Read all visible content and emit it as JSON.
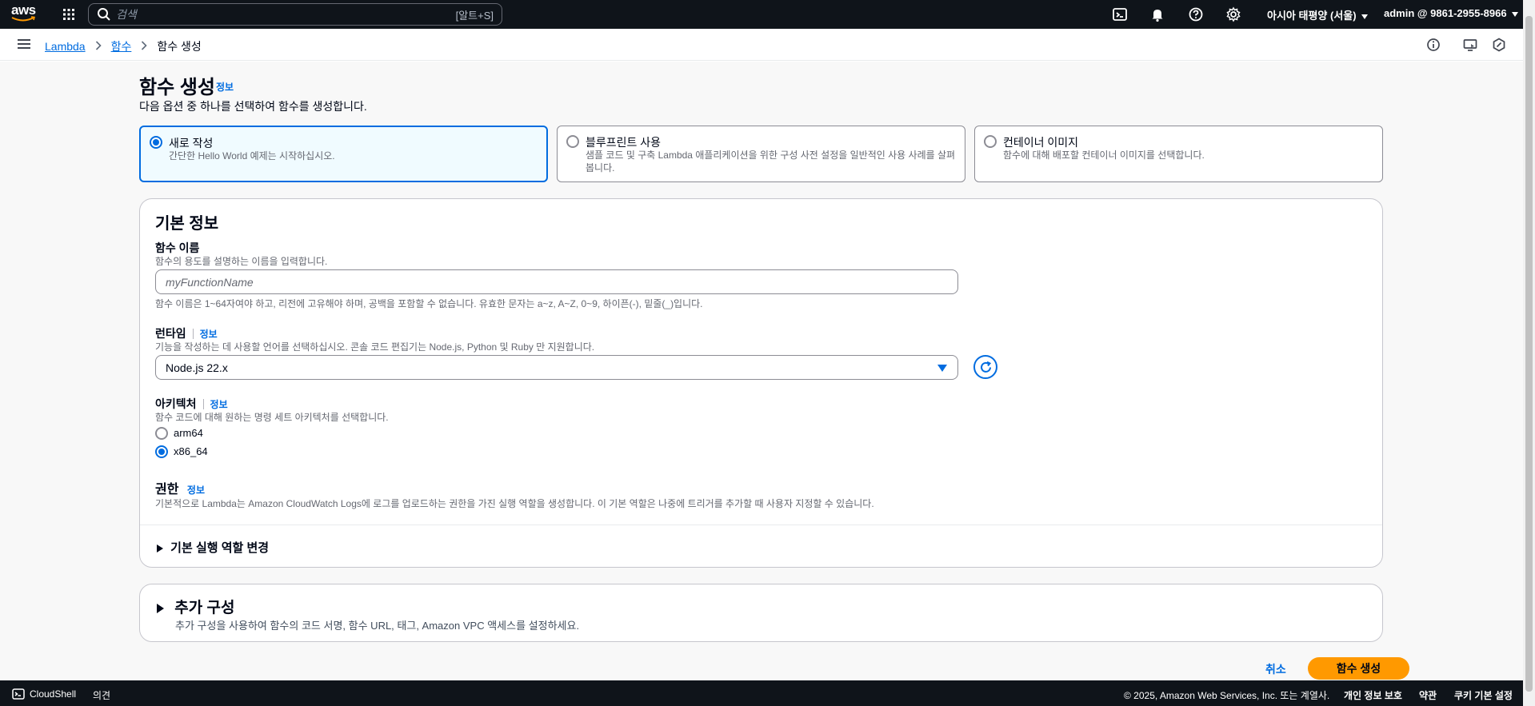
{
  "topnav": {
    "logo_text": "aws",
    "search_placeholder": "검색",
    "search_shortcut": "[알트+S]",
    "region": "아시아 태평양 (서울)",
    "account": "admin @ 9861-2955-8966",
    "icons": [
      "grid-icon",
      "search-icon",
      "cloudshell-icon",
      "bell-icon",
      "help-icon",
      "gear-icon"
    ]
  },
  "breadcrumb": {
    "items": [
      "Lambda",
      "함수",
      "함수 생성"
    ]
  },
  "page": {
    "title": "함수 생성",
    "info": "정보",
    "description": "다음 옵션 중 하나를 선택하여 함수를 생성합니다."
  },
  "options": [
    {
      "label": "새로 작성",
      "description": "간단한 Hello World 예제는 시작하십시오.",
      "selected": true
    },
    {
      "label": "블루프린트 사용",
      "description": "샘플 코드 및 구축 Lambda 애플리케이션을 위한 구성 사전 설정을 일반적인 사용 사례를 살펴봅니다.",
      "selected": false
    },
    {
      "label": "컨테이너 이미지",
      "description": "함수에 대해 배포할 컨테이너 이미지를 선택합니다.",
      "selected": false
    }
  ],
  "basic": {
    "title": "기본 정보",
    "function_name": {
      "label": "함수 이름",
      "description": "함수의 용도를 설명하는 이름을 입력합니다.",
      "placeholder": "myFunctionName",
      "value": "",
      "hint": "함수 이름은 1~64자여야 하고, 리전에 고유해야 하며, 공백을 포함할 수 없습니다. 유효한 문자는 a~z, A~Z, 0~9, 하이픈(-), 밑줄(_)입니다."
    },
    "runtime": {
      "label": "런타임",
      "info": "정보",
      "description": "기능을 작성하는 데 사용할 언어를 선택하십시오. 콘솔 코드 편집기는 Node.js, Python 및 Ruby 만 지원합니다.",
      "value": "Node.js 22.x"
    },
    "architecture": {
      "label": "아키텍처",
      "info": "정보",
      "description": "함수 코드에 대해 원하는 명령 세트 아키텍처를 선택합니다.",
      "options": [
        "arm64",
        "x86_64"
      ],
      "selected": "x86_64"
    },
    "permissions": {
      "label": "권한",
      "info": "정보",
      "description": "기본적으로 Lambda는 Amazon CloudWatch Logs에 로그를 업로드하는 권한을 가진 실행 역할을 생성합니다. 이 기본 역할은 나중에 트리거를 추가할 때 사용자 지정할 수 있습니다."
    },
    "execution_role_toggle": "기본 실행 역할 변경"
  },
  "additional": {
    "title": "추가 구성",
    "description": "추가 구성을 사용하여 함수의 코드 서명, 함수 URL, 태그, Amazon VPC 액세스를 설정하세요."
  },
  "actions": {
    "cancel": "취소",
    "create": "함수 생성"
  },
  "footer": {
    "cloudshell": "CloudShell",
    "feedback": "의견",
    "copyright": "© 2025, Amazon Web Services, Inc. 또는 계열사.",
    "links": [
      "개인 정보 보호",
      "약관",
      "쿠키 기본 설정"
    ]
  },
  "colors": {
    "nav_bg": "#0f141a",
    "link": "#006ce0",
    "primary_button": "#ff9900",
    "selected_bg": "#f0fbff"
  }
}
